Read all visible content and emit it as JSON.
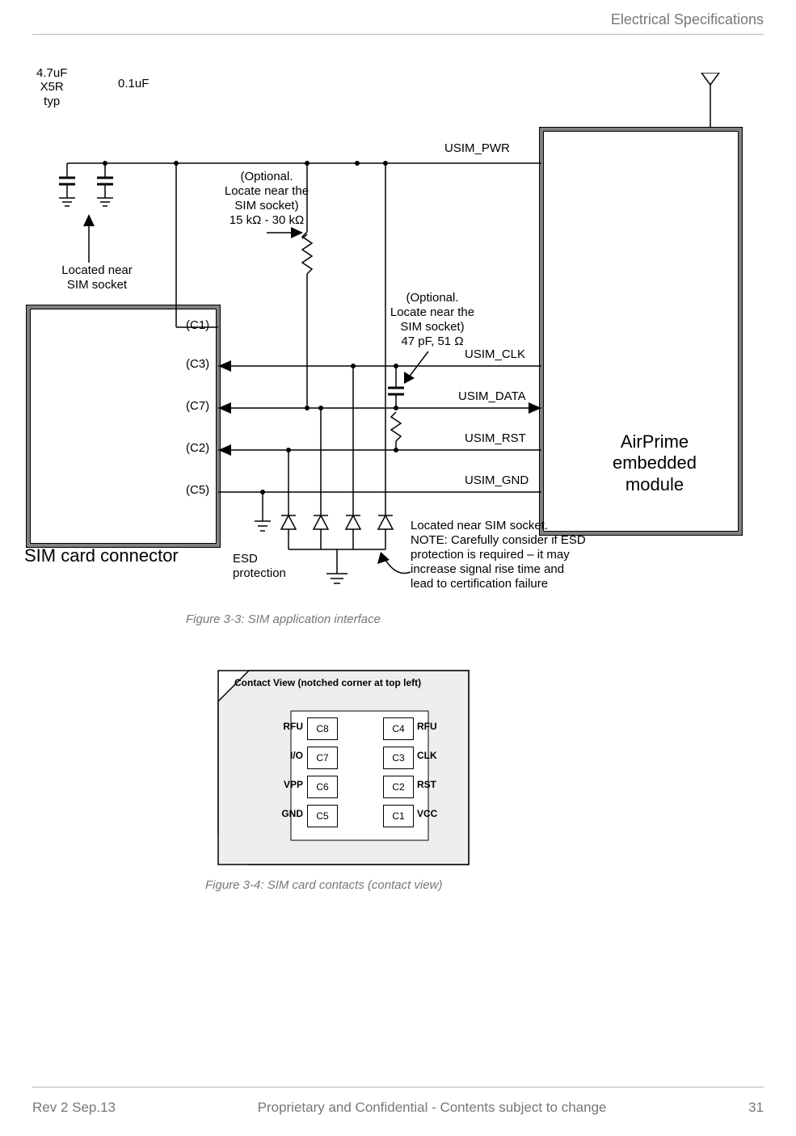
{
  "header": {
    "title": "Electrical Specifications"
  },
  "diagram1": {
    "sim_connector_label": "SIM card connector",
    "pins": [
      "(C1)",
      "(C3)",
      "(C7)",
      "(C2)",
      "(C5)"
    ],
    "module_label_l1": "AirPrime",
    "module_label_l2": "embedded",
    "module_label_l3": "module",
    "signals": {
      "pwr": "USIM_PWR",
      "clk": "USIM_CLK",
      "data": "USIM_DATA",
      "rst": "USIM_RST",
      "gnd": "USIM_GND"
    },
    "cap1": "4.7uF",
    "cap1b": "X5R",
    "cap1c": "typ",
    "cap2": "0.1uF",
    "located_near_l1": "Located near",
    "located_near_l2": "SIM socket",
    "opt_res_l1": "(Optional.",
    "opt_res_l2": "Locate near the",
    "opt_res_l3": "SIM socket)",
    "opt_res_l4": "15 kΩ - 30 kΩ",
    "opt_cap_l1": "(Optional.",
    "opt_cap_l2": "Locate near the",
    "opt_cap_l3": "SIM socket)",
    "opt_cap_l4": "47 pF, 51 Ω",
    "esd_l1": "ESD",
    "esd_l2": "protection",
    "note_l1": "Located near SIM socket.",
    "note_l2": "NOTE: Carefully consider if ESD",
    "note_l3": "protection is required – it may",
    "note_l4": "increase signal rise time and",
    "note_l5": "lead to certification failure"
  },
  "caption1": "Figure 3-3:  SIM application interface",
  "diagram2": {
    "title": "Contact View (notched corner at top left)",
    "left_labels": [
      "RFU",
      "I/O",
      "VPP",
      "GND"
    ],
    "right_labels": [
      "RFU",
      "CLK",
      "RST",
      "VCC"
    ],
    "left_pads": [
      "C8",
      "C7",
      "C6",
      "C5"
    ],
    "right_pads": [
      "C4",
      "C3",
      "C2",
      "C1"
    ]
  },
  "caption2": "Figure 3-4:  SIM card contacts (contact view)",
  "footer": {
    "left": "Rev 2  Sep.13",
    "center": "Proprietary and Confidential - Contents subject to change",
    "right": "31"
  }
}
